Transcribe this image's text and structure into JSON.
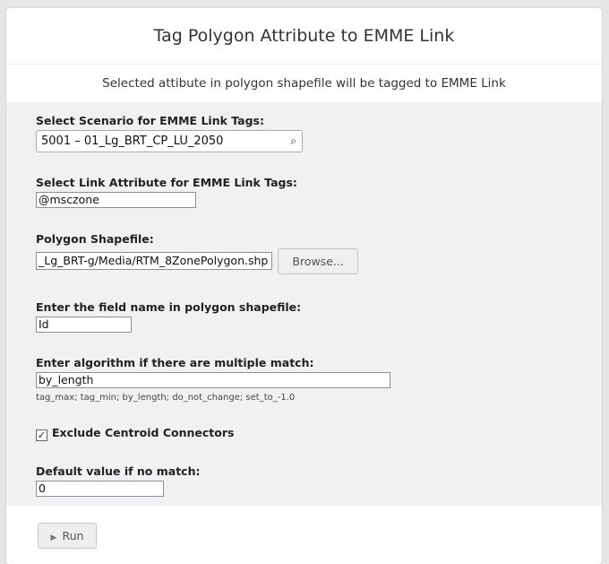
{
  "header": {
    "title": "Tag Polygon Attribute to EMME Link",
    "subtitle": "Selected attibute in polygon shapefile will be tagged to EMME Link"
  },
  "form": {
    "scenario": {
      "label": "Select Scenario for EMME Link Tags:",
      "value": "5001 – 01_Lg_BRT_CP_LU_2050",
      "icon": "search-icon"
    },
    "link_attribute": {
      "label": "Select Link Attribute for EMME Link Tags:",
      "value": "@msczone"
    },
    "shapefile": {
      "label": "Polygon Shapefile:",
      "value": "_Lg_BRT-g/Media/RTM_8ZonePolygon.shp",
      "browse_label": "Browse..."
    },
    "field_name": {
      "label": "Enter the field name in polygon shapefile:",
      "value": "Id"
    },
    "algorithm": {
      "label": "Enter algorithm if there are multiple match:",
      "value": "by_length",
      "hint": "tag_max; tag_min; by_length; do_not_change; set_to_-1.0"
    },
    "exclude_centroid": {
      "label": "Exclude Centroid Connectors",
      "checked": true
    },
    "default_value": {
      "label": "Default value if no match:",
      "value": "0"
    }
  },
  "actions": {
    "run_label": "Run"
  }
}
